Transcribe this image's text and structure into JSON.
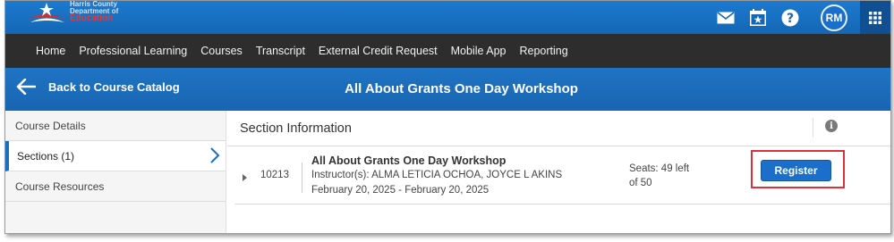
{
  "header": {
    "logo_text": [
      "Harris County",
      "Department of",
      "Education"
    ],
    "avatar_initials": "RM"
  },
  "nav": {
    "items": [
      "Home",
      "Professional Learning",
      "Courses",
      "Transcript",
      "External Credit Request",
      "Mobile App",
      "Reporting"
    ]
  },
  "titlebar": {
    "back_label": "Back to Course Catalog",
    "page_title": "All About Grants One Day Workshop"
  },
  "sidebar": {
    "items": [
      {
        "label": "Course Details"
      },
      {
        "label": "Sections (1)"
      },
      {
        "label": "Course Resources"
      }
    ]
  },
  "main": {
    "section_title": "Section Information",
    "row": {
      "section_id": "10213",
      "course_name": "All About Grants One Day Workshop",
      "instructors": "Instructor(s): ALMA LETICIA OCHOA, JOYCE L AKINS",
      "dates": "February 20, 2025 - February 20, 2025",
      "seats_line1": "Seats: 49 left",
      "seats_line2": "of 50",
      "register_label": "Register"
    }
  },
  "colors": {
    "brand_blue": "#1b6fcb",
    "nav_dark": "#2d2d2d",
    "highlight_red": "#d9323a"
  },
  "icons": [
    "mail-icon",
    "calendar-star-icon",
    "help-icon",
    "apps-grid-icon",
    "back-arrow-icon",
    "chevron-right-icon",
    "info-icon",
    "expand-caret-icon"
  ]
}
